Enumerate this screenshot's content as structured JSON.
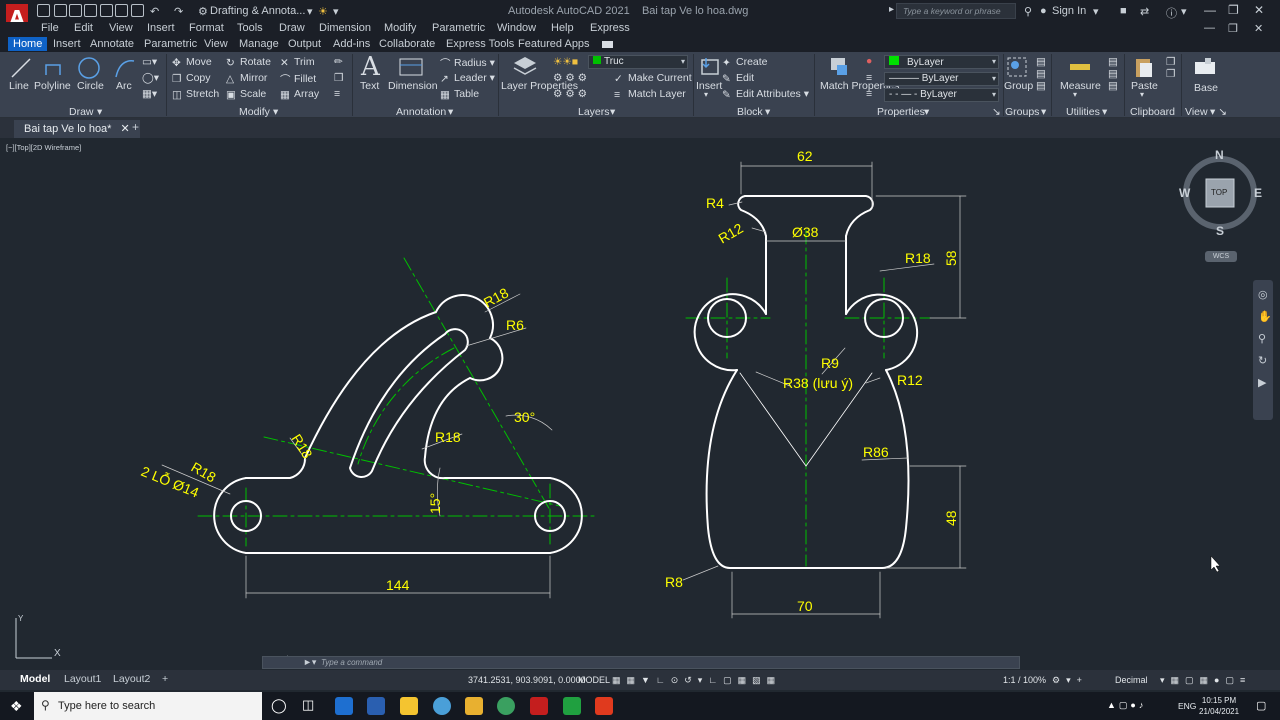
{
  "title_bar": {
    "workspace": "Drafting & Annota...",
    "app_title": "Autodesk AutoCAD 2021",
    "file_name": "Bai tap Ve lo hoa.dwg",
    "search_placeholder": "Type a keyword or phrase",
    "sign_in": "Sign In"
  },
  "menu_bar": [
    "File",
    "Edit",
    "View",
    "Insert",
    "Format",
    "Tools",
    "Draw",
    "Dimension",
    "Modify",
    "Parametric",
    "Window",
    "Help",
    "Express"
  ],
  "ribbon_tabs": [
    "Home",
    "Insert",
    "Annotate",
    "Parametric",
    "View",
    "Manage",
    "Output",
    "Add-ins",
    "Collaborate",
    "Express Tools",
    "Featured Apps"
  ],
  "ribbon": {
    "draw": {
      "title": "Draw",
      "line": "Line",
      "polyline": "Polyline",
      "circle": "Circle",
      "arc": "Arc"
    },
    "modify": {
      "title": "Modify",
      "move": "Move",
      "rotate": "Rotate",
      "trim": "Trim",
      "copy": "Copy",
      "mirror": "Mirror",
      "fillet": "Fillet",
      "stretch": "Stretch",
      "scale": "Scale",
      "array": "Array"
    },
    "annotation": {
      "title": "Annotation",
      "text": "Text",
      "dimension": "Dimension",
      "radius": "Radius",
      "leader": "Leader",
      "table": "Table"
    },
    "layers": {
      "title": "Layers",
      "layer_properties": "Layer Properties",
      "current_layer": "Truc",
      "make_current": "Make Current",
      "match_layer": "Match Layer"
    },
    "block": {
      "title": "Block",
      "insert": "Insert",
      "create": "Create",
      "edit": "Edit",
      "edit_attributes": "Edit Attributes"
    },
    "properties": {
      "title": "Properties",
      "match_properties": "Match Properties",
      "color": "ByLayer",
      "lineweight": "ByLayer",
      "linetype": "ByLayer"
    },
    "groups": {
      "title": "Groups",
      "group": "Group"
    },
    "utilities": {
      "title": "Utilities",
      "measure": "Measure"
    },
    "clipboard": {
      "title": "Clipboard",
      "paste": "Paste"
    },
    "view": {
      "title": "View",
      "base": "Base"
    }
  },
  "doc_tab": {
    "name": "Bai tap Ve lo hoa*"
  },
  "viewport_label": "[−][Top][2D Wireframe]",
  "viewcube": {
    "north": "N",
    "south": "S",
    "east": "E",
    "west": "W",
    "face": "TOP",
    "ucs": "WCS"
  },
  "drawing_left": {
    "dims": {
      "r18_top": "R18",
      "r6": "R6",
      "r18_mid": "R18",
      "r18_left": "R18",
      "angle30": "30°",
      "angle15": "15°",
      "holes": "2 LỖ Ø14",
      "r18_hole": "R18",
      "len144": "144"
    }
  },
  "drawing_right": {
    "dims": {
      "w62": "62",
      "r4": "R4",
      "r12_top": "R12",
      "dia38": "Ø38",
      "r18": "R18",
      "h58": "58",
      "r9": "R9",
      "r38": "R38 (lưu ý)",
      "r12": "R12",
      "r86": "R86",
      "h48": "48",
      "r8": "R8",
      "w70": "70"
    }
  },
  "command_line": {
    "placeholder": "Type a command"
  },
  "layout_tabs": [
    "Model",
    "Layout1",
    "Layout2"
  ],
  "status_bar": {
    "coordinates": "3741.2531, 903.9091, 0.0000",
    "space": "MODEL",
    "scale": "1:1 / 100%",
    "units": "Decimal"
  },
  "taskbar": {
    "search_placeholder": "Type here to search",
    "language": "ENG",
    "time": "10:15 PM",
    "date": "21/04/2021"
  },
  "colors": {
    "dimension": "#ffff00",
    "centerline": "#00c000",
    "object": "#ffffff",
    "canvas": "#212830",
    "ribbon": "#3a4250"
  }
}
